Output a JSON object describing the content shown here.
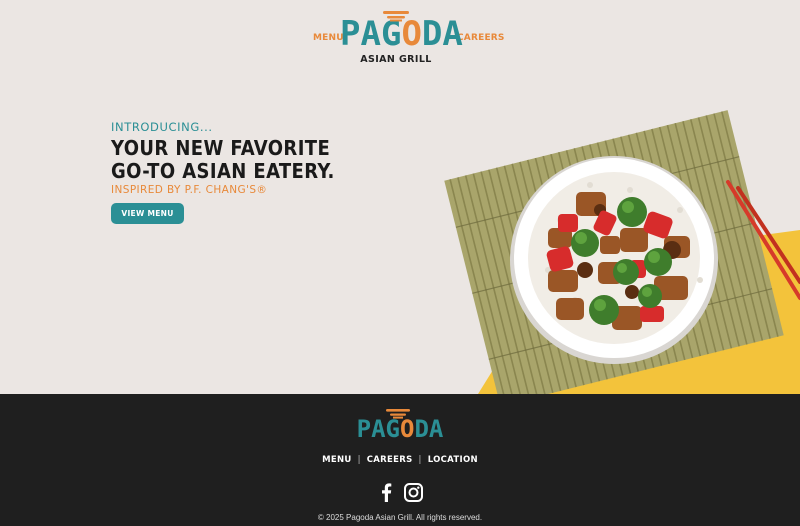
{
  "header": {
    "nav_left": "MENU",
    "nav_right": "CAREERS",
    "logo_left": "PA",
    "logo_g": "G",
    "logo_o": "O",
    "logo_right": "DA",
    "logo_sub": "ASIAN GRILL"
  },
  "hero": {
    "intro": "INTRODUCING...",
    "headline_line1": "YOUR NEW FAVORITE",
    "headline_line2": "GO-TO ASIAN EATERY.",
    "inspired": "INSPIRED BY P.F. CHANG'S®",
    "cta_label": "VIEW MENU"
  },
  "footer": {
    "logo_left": "PAG",
    "logo_o": "O",
    "logo_right": "DA",
    "links": [
      "MENU",
      "CAREERS",
      "LOCATION"
    ],
    "separator": "|",
    "social": [
      "facebook-icon",
      "instagram-icon"
    ],
    "copyright": "© 2025 Pagoda Asian Grill. All rights reserved."
  },
  "colors": {
    "teal": "#2b8f95",
    "orange": "#e8893a",
    "background": "#ebe6e3",
    "footer": "#1f1f1f",
    "yellow": "#f3c33b",
    "chopsticks": "#d63a2a"
  }
}
